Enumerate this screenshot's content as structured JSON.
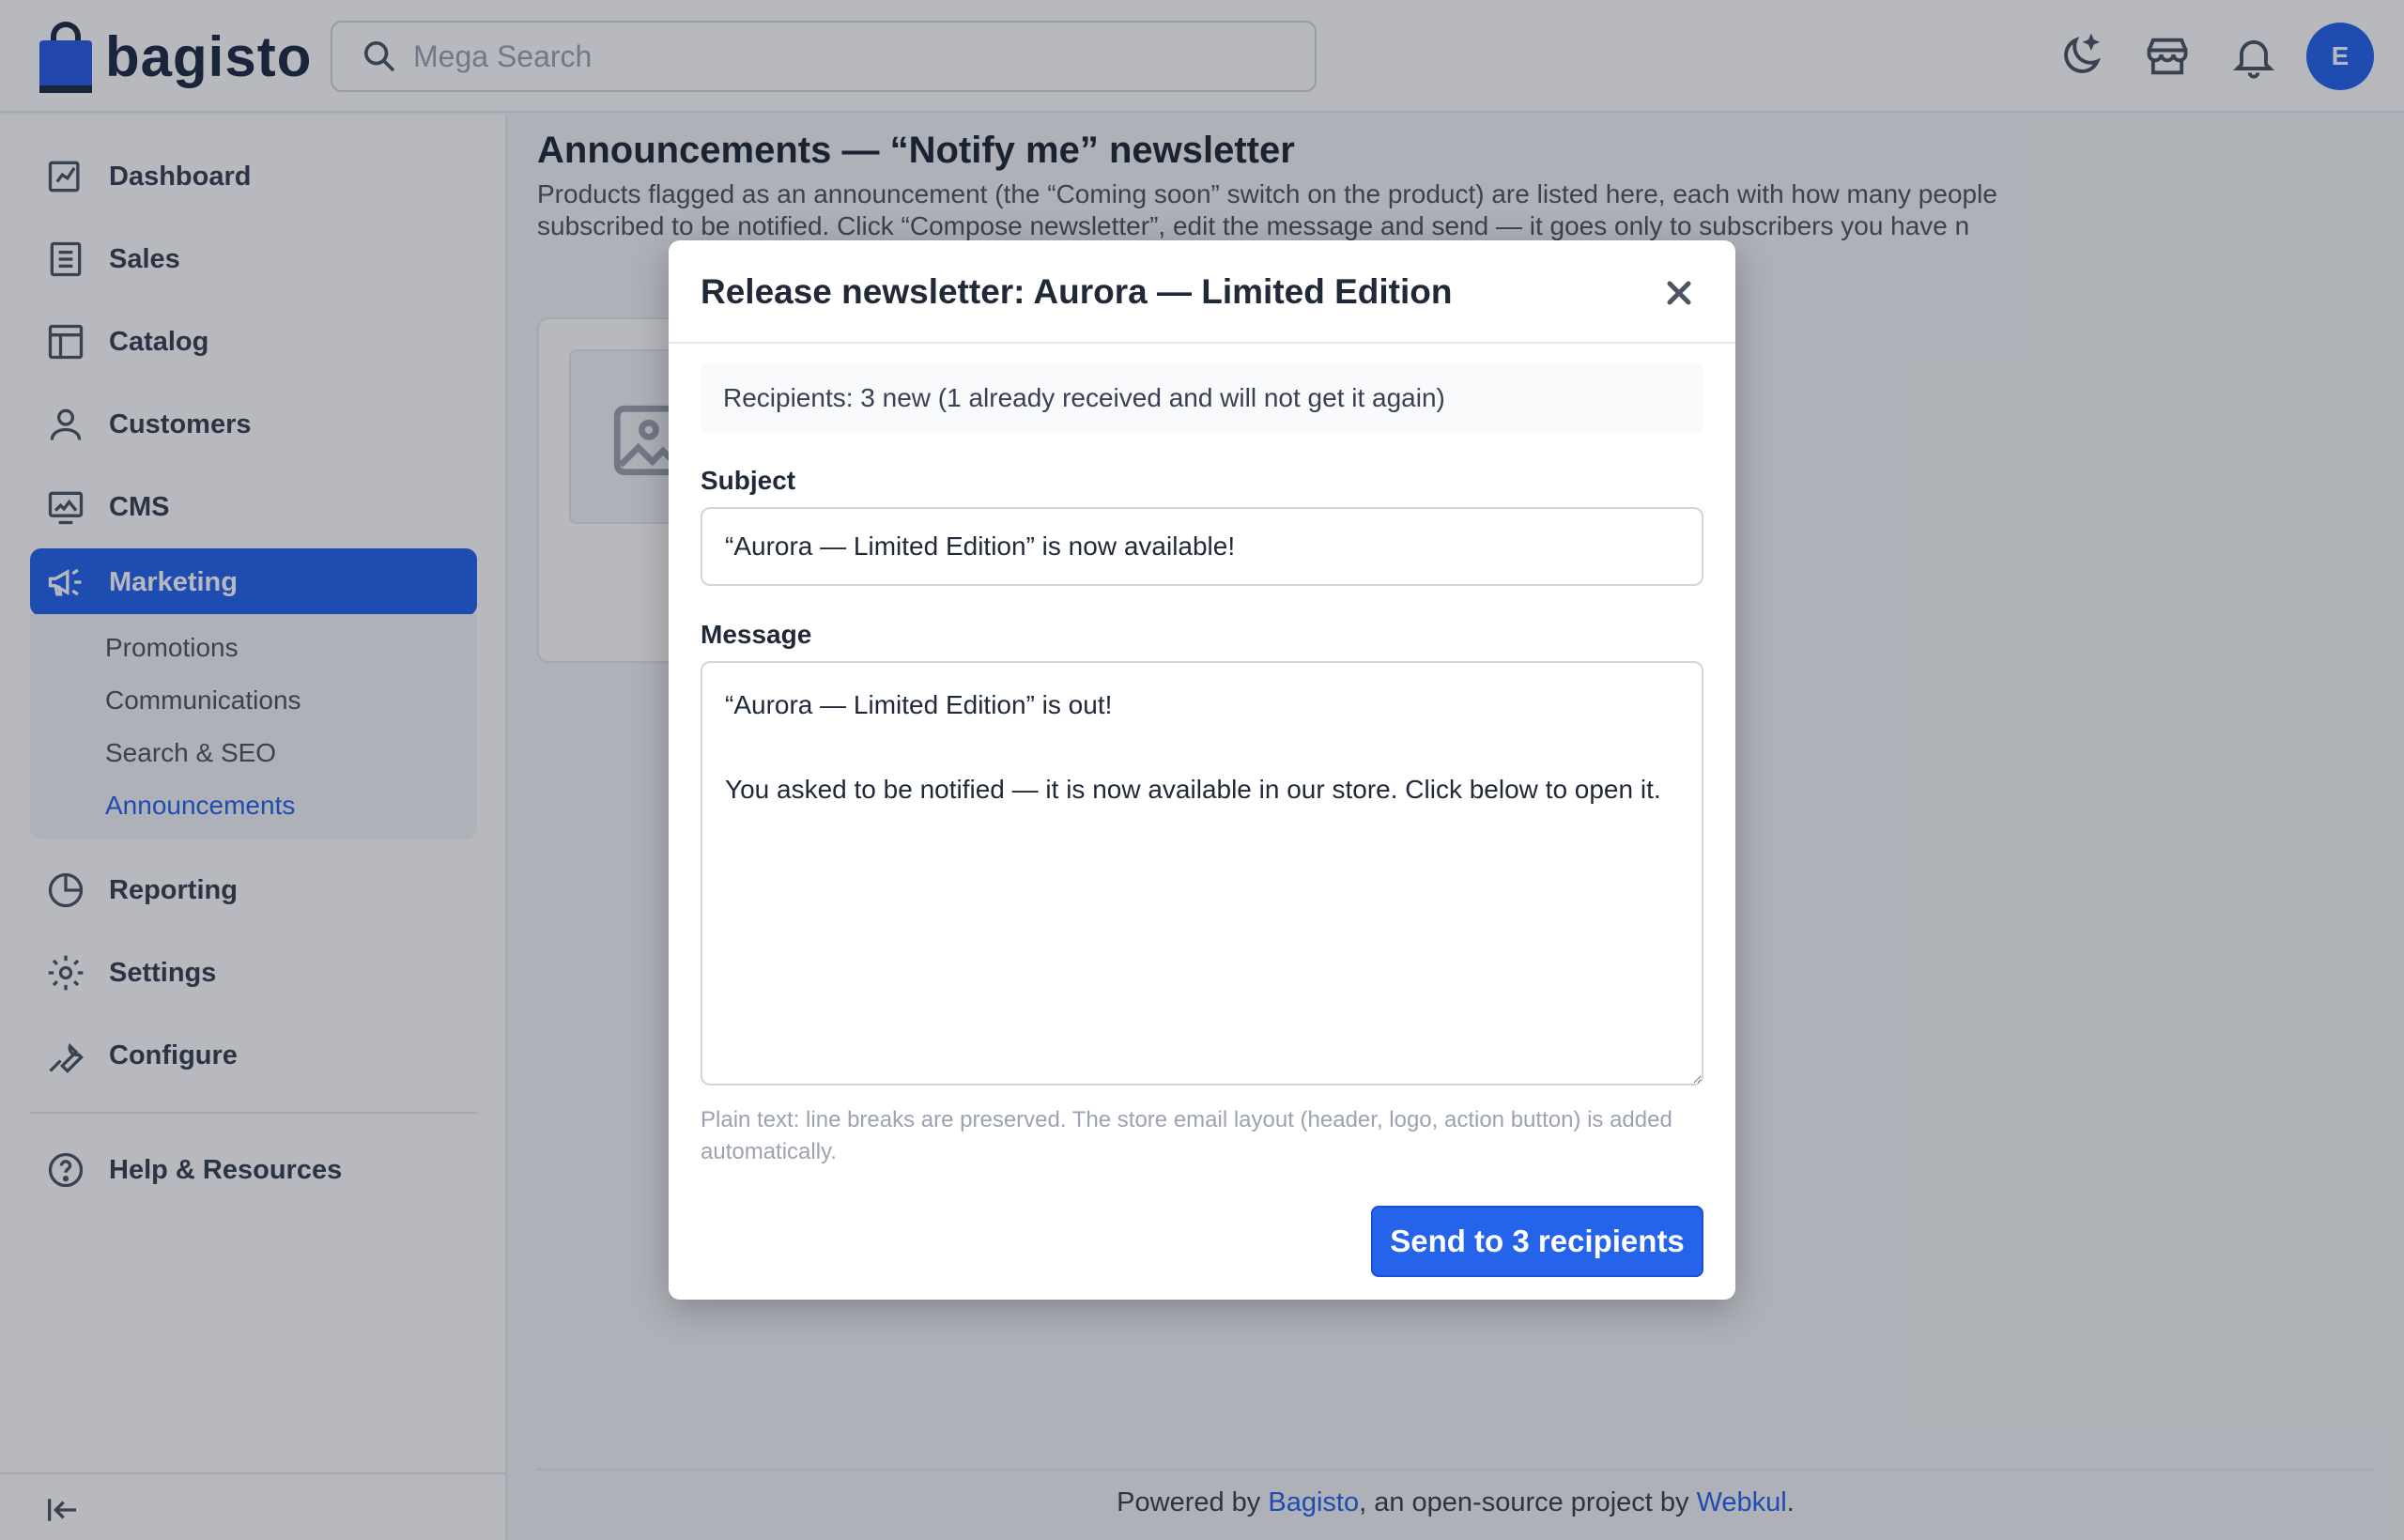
{
  "brand": {
    "name": "bagisto"
  },
  "header": {
    "search_placeholder": "Mega Search",
    "avatar_initial": "E"
  },
  "sidebar": {
    "items": [
      {
        "label": "Dashboard",
        "icon": "dashboard-icon"
      },
      {
        "label": "Sales",
        "icon": "sales-icon"
      },
      {
        "label": "Catalog",
        "icon": "catalog-icon"
      },
      {
        "label": "Customers",
        "icon": "customers-icon"
      },
      {
        "label": "CMS",
        "icon": "cms-icon"
      },
      {
        "label": "Marketing",
        "icon": "megaphone-icon",
        "active": true
      },
      {
        "label": "Reporting",
        "icon": "reporting-icon"
      },
      {
        "label": "Settings",
        "icon": "gear-icon"
      },
      {
        "label": "Configure",
        "icon": "wrench-icon"
      },
      {
        "label": "Help & Resources",
        "icon": "help-icon"
      }
    ],
    "submenu": [
      {
        "label": "Promotions"
      },
      {
        "label": "Communications"
      },
      {
        "label": "Search & SEO"
      },
      {
        "label": "Announcements",
        "active": true
      }
    ]
  },
  "page": {
    "title": "Announcements — “Notify me” newsletter",
    "description": "Products flagged as an announcement (the “Coming soon” switch on the product) are listed here, each with how many people subscribed to be notified. Click “Compose newsletter”, edit the message and send — it goes only to subscribers you have n"
  },
  "modal": {
    "title": "Release newsletter: Aurora — Limited Edition",
    "recipients_text": "Recipients: 3 new (1 already received and will not get it again)",
    "subject_label": "Subject",
    "subject_value": "“Aurora — Limited Edition” is now available!",
    "message_label": "Message",
    "message_value": "“Aurora — Limited Edition” is out!\n\nYou asked to be notified — it is now available in our store. Click below to open it.",
    "hint": "Plain text: line breaks are preserved. The store email layout (header, logo, action button) is added automatically.",
    "send_label": "Send to 3 recipients"
  },
  "footer": {
    "prefix": "Powered by ",
    "link1": "Bagisto",
    "middle": ", an open-source project by ",
    "link2": "Webkul",
    "suffix": "."
  },
  "colors": {
    "accent": "#2563eb",
    "logo_blue": "#2a5ce6",
    "logo_dark": "#1f2a44"
  }
}
